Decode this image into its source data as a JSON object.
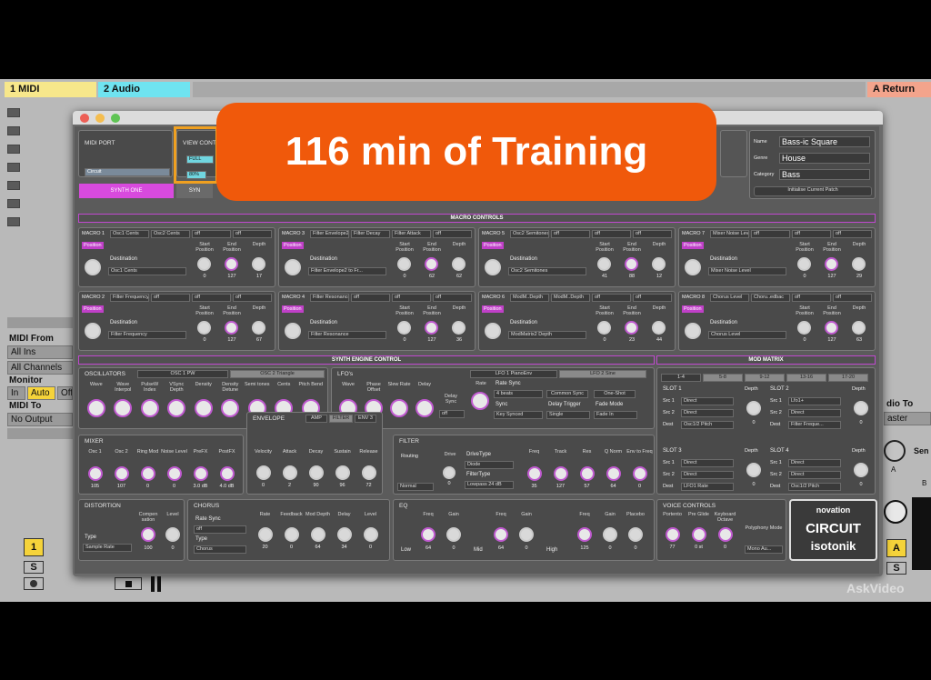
{
  "tracks": [
    {
      "name": "1 MIDI",
      "color": "#f7e78b"
    },
    {
      "name": "2 Audio",
      "color": "#6fe3f0"
    },
    {
      "name": "A Return",
      "color": "#f3a48c"
    }
  ],
  "daw": {
    "midi_from": "MIDI From",
    "all_ins": "All Ins",
    "all_channels": "All Channels",
    "monitor": "Monitor",
    "mon_in": "In",
    "mon_auto": "Auto",
    "mon_off": "Off",
    "midi_to": "MIDI To",
    "no_output": "No Output",
    "audio_to": "dio To",
    "master": "aster",
    "track_num": "1",
    "solo": "S",
    "a_btn": "A",
    "s_btn": "S",
    "send_label": "Sen",
    "send_a": "A",
    "send_b": "B"
  },
  "plugin": {
    "midi_port": {
      "title": "MIDI PORT",
      "value": "Circuit"
    },
    "view": {
      "title": "VIEW CONT",
      "full": "FULL",
      "pct": "80%"
    },
    "synth_tabs": [
      "SYNTH ONE",
      "SYN"
    ],
    "patch": {
      "name_label": "Name",
      "name": "Bass-ic Square",
      "genre_label": "Genre",
      "genre": "House",
      "category_label": "Category",
      "category": "Bass",
      "init": "Initialise Current Patch"
    },
    "macro_title": "MACRO CONTROLS",
    "macros": [
      {
        "label": "MACRO 1",
        "tabs": [
          "Osc1 Cents",
          "Osc2 Cents",
          "off",
          "off"
        ],
        "dest": "Osc1 Cents",
        "start": "0",
        "end": "127",
        "depth": "17"
      },
      {
        "label": "MACRO 3",
        "tabs": [
          "Filter Envelope2",
          "Filter Decay",
          "Filter Attack",
          "off"
        ],
        "dest": "Filter Envelope2 to Fr...",
        "start": "0",
        "end": "62",
        "depth": "62"
      },
      {
        "label": "MACRO 5",
        "tabs": [
          "Osc2 Semitones",
          "off",
          "off",
          "off"
        ],
        "dest": "Osc2 Semitones",
        "start": "41",
        "end": "88",
        "depth": "12"
      },
      {
        "label": "MACRO 7",
        "tabs": [
          "Mixer Noise Level",
          "off",
          "off",
          "off"
        ],
        "dest": "Mixer Noise Level",
        "start": "0",
        "end": "127",
        "depth": "29"
      },
      {
        "label": "MACRO 2",
        "tabs": [
          "Filter Frequency",
          "off",
          "off",
          "off"
        ],
        "dest": "Filter Frequency",
        "start": "0",
        "end": "127",
        "depth": "67"
      },
      {
        "label": "MACRO 4",
        "tabs": [
          "Filter Resonance",
          "off",
          "off",
          "off"
        ],
        "dest": "Filter Resonance",
        "start": "0",
        "end": "127",
        "depth": "36"
      },
      {
        "label": "MACRO 6",
        "tabs": [
          "ModM..Depth",
          "ModM..Depth",
          "off",
          "off"
        ],
        "dest": "ModMatrix2 Depth",
        "start": "0",
        "end": "23",
        "depth": "44"
      },
      {
        "label": "MACRO 8",
        "tabs": [
          "Chorus Level",
          "Choru..edbac",
          "off",
          "off"
        ],
        "dest": "Chorus Level",
        "start": "0",
        "end": "127",
        "depth": "63"
      }
    ],
    "macro_col_labels": {
      "position": "Position",
      "dest": "Destination",
      "start": "Start Position",
      "end": "End Position",
      "depth": "Depth"
    },
    "synth_engine_title": "SYNTH ENGINE CONTROL",
    "osc": {
      "title": "OSCILLATORS",
      "tab1": "OSC 1 PW",
      "tab2": "OSC 2 Triangle",
      "knobs": [
        "Wave",
        "Wave Interpol",
        "PulseW Index",
        "VSync Depth",
        "Density",
        "Density Detune",
        "Semi tones",
        "Cents",
        "Pitch Bend"
      ]
    },
    "lfo": {
      "title": "LFO's",
      "tab1": "LFO 1 PianoEnv",
      "tab2": "LFO 2 Sine",
      "knobs": [
        "Wave",
        "Phase Offset",
        "Slew Rate",
        "Delay"
      ],
      "delay_sync": "Delay Sync",
      "delay_sync_val": "off",
      "rate": "Rate",
      "rate_sync": "Rate Sync",
      "rate_sync_val": "4 beats",
      "common_sync": "Common Sync",
      "one_shot": "One-Shot",
      "sync": "Sync",
      "sync_val": "Key Synced",
      "delay_trigger": "Delay Trigger",
      "delay_trigger_val": "Single",
      "fade_mode": "Fade Mode",
      "fade_mode_val": "Fade In"
    },
    "mixer": {
      "title": "MIXER",
      "knobs": [
        "Osc 1",
        "Osc 2",
        "Ring Mod",
        "Noise Level",
        "PreFX",
        "PostFX"
      ],
      "values": [
        "105",
        "107",
        "0",
        "0",
        "3.0 dB",
        "4.0 dB"
      ]
    },
    "envelope": {
      "title": "ENVELOPE",
      "tabs": [
        "AMP",
        "FILTER",
        "ENV 3"
      ],
      "knobs": [
        "Velocity",
        "Attack",
        "Decay",
        "Sustain",
        "Release"
      ],
      "values": [
        "0",
        "2",
        "90",
        "96",
        "72"
      ]
    },
    "filter": {
      "title": "FILTER",
      "routing": "Routing",
      "routing_val": "Normal",
      "drive": "Drive",
      "drive_type": "DriveType",
      "drive_type_val": "Diode",
      "filter_type": "FilterType",
      "filter_type_val": "Lowpass 24 dB",
      "knobs": [
        "Freq",
        "Track",
        "Res",
        "Q Norm",
        "Env to Freq"
      ],
      "values": [
        "35",
        "127",
        "57",
        "64",
        "0"
      ],
      "drive_val": "0"
    },
    "mod_matrix": {
      "title": "MOD MATRIX",
      "tabs": [
        "1-4",
        "5-8",
        "9-12",
        "13-16",
        "17-20"
      ],
      "slots": [
        {
          "name": "SLOT 1",
          "src1": "Direct",
          "src2": "Direct",
          "dest": "Osc1/2 Pitch",
          "depth": "0"
        },
        {
          "name": "SLOT 2",
          "src1": "Lfo1+",
          "src2": "Direct",
          "dest": "Filter Freque...",
          "depth": "0"
        },
        {
          "name": "SLOT 3",
          "src1": "Direct",
          "src2": "Direct",
          "dest": "LFO1 Rate",
          "depth": "0"
        },
        {
          "name": "SLOT 4",
          "src1": "Direct",
          "src2": "Direct",
          "dest": "Osc1/2 Pitch",
          "depth": "0"
        }
      ],
      "src1": "Src 1",
      "src2": "Src 2",
      "dest": "Dest",
      "depth": "Depth"
    },
    "distortion": {
      "title": "DISTORTION",
      "comp": "Compen sation",
      "level": "Level",
      "type": "Type",
      "type_val": "Sample Rate",
      "comp_val": "100",
      "level_val": "0"
    },
    "chorus": {
      "title": "CHORUS",
      "rate_sync": "Rate Sync",
      "rate_sync_val": "off",
      "type": "Type",
      "type_val": "Chorus",
      "knobs": [
        "Rate",
        "Feedback",
        "Mod Depth",
        "Delay",
        "Level"
      ],
      "values": [
        "20",
        "0",
        "64",
        "34",
        "0"
      ]
    },
    "eq": {
      "title": "EQ",
      "low": "Low",
      "mid": "Mid",
      "high": "High",
      "freq": "Freq",
      "gain": "Gain",
      "placebo": "Placebo",
      "values": [
        "64",
        "0",
        "64",
        "0",
        "125",
        "0",
        "0"
      ]
    },
    "voice": {
      "title": "VOICE CONTROLS",
      "knobs": [
        "Portento",
        "Pre Glide",
        "Keyboard Octave"
      ],
      "values": [
        "77",
        "0 st",
        "0"
      ],
      "poly": "Polyphony Mode",
      "poly_val": "Mono Au..."
    },
    "brand": {
      "novation": "novation",
      "circuit": "CIRCUIT",
      "isotonik": "isotonik"
    }
  },
  "banner": "116 min of Training",
  "watermark": "AskVideo"
}
